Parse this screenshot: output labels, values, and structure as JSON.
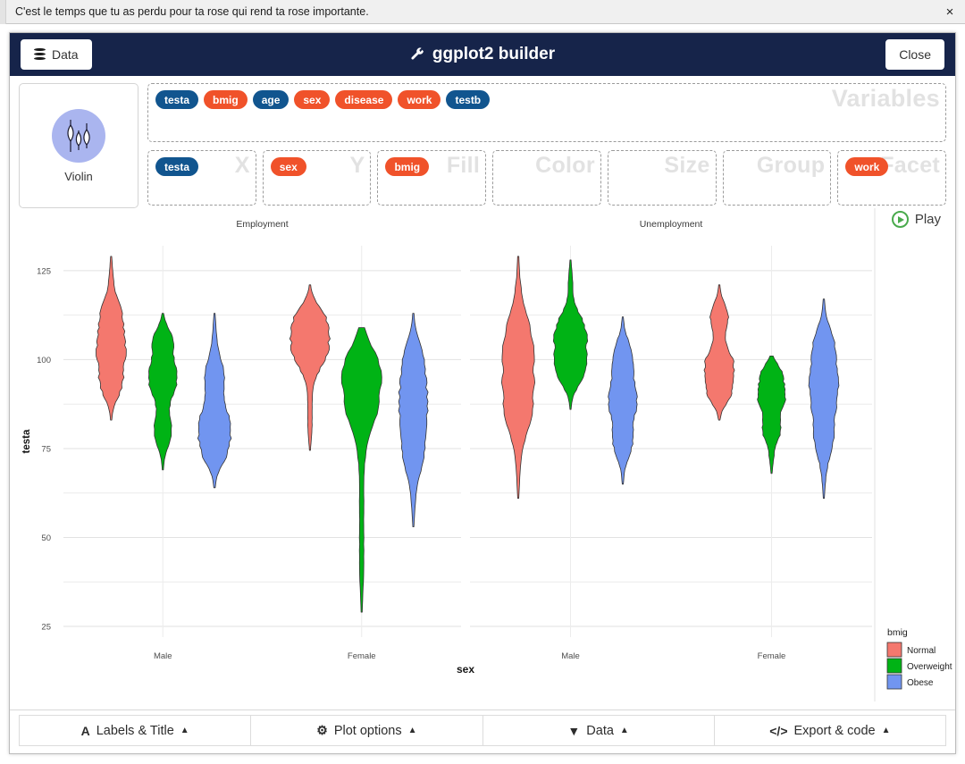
{
  "notice": {
    "text": "C'est le temps que tu as perdu pour ta rose qui rend ta rose importante.",
    "close_icon": "close-icon",
    "close_glyph": "×"
  },
  "header": {
    "data_button": "Data",
    "data_icon": "database-icon",
    "title": "ggplot2 builder",
    "title_icon": "wrench-icon",
    "title_glyph": "🔧",
    "close_button": "Close"
  },
  "geom": {
    "name": "Violin",
    "icon": "violin-plot-icon"
  },
  "variables": {
    "ghost_label": "Variables",
    "items": [
      {
        "label": "testa",
        "type": "num"
      },
      {
        "label": "bmig",
        "type": "cat"
      },
      {
        "label": "age",
        "type": "num"
      },
      {
        "label": "sex",
        "type": "cat"
      },
      {
        "label": "disease",
        "type": "cat"
      },
      {
        "label": "work",
        "type": "cat"
      },
      {
        "label": "testb",
        "type": "num"
      }
    ]
  },
  "slots": [
    {
      "ghost_label": "X",
      "pills": [
        {
          "label": "testa",
          "type": "num"
        }
      ]
    },
    {
      "ghost_label": "Y",
      "pills": [
        {
          "label": "sex",
          "type": "cat"
        }
      ]
    },
    {
      "ghost_label": "Fill",
      "pills": [
        {
          "label": "bmig",
          "type": "cat"
        }
      ]
    },
    {
      "ghost_label": "Color",
      "pills": []
    },
    {
      "ghost_label": "Size",
      "pills": []
    },
    {
      "ghost_label": "Group",
      "pills": []
    },
    {
      "ghost_label": "Facet",
      "pills": [
        {
          "label": "work",
          "type": "cat"
        }
      ]
    }
  ],
  "play": {
    "label": "Play",
    "icon": "play-circle-icon"
  },
  "bottom_bar": [
    {
      "label": "Labels & Title",
      "icon": "font-icon",
      "glyph": "A",
      "caret": "▲"
    },
    {
      "label": "Plot options",
      "icon": "sliders-icon",
      "glyph": "⚙",
      "caret": "▲"
    },
    {
      "label": "Data",
      "icon": "filter-icon",
      "glyph": "▼",
      "caret": "▲"
    },
    {
      "label": "Export & code",
      "icon": "code-icon",
      "glyph": "</>",
      "caret": "▲"
    }
  ],
  "chart_data": {
    "type": "violin",
    "title": "",
    "xlabel": "sex",
    "ylabel": "testa",
    "ylim": [
      22,
      132
    ],
    "yticks": [
      25,
      50,
      75,
      100,
      125
    ],
    "yminor": [
      37.5,
      62.5,
      87.5,
      112.5
    ],
    "grid": true,
    "categories": [
      "Male",
      "Female"
    ],
    "facet_var": "work",
    "facets": [
      "Employment",
      "Unemployment"
    ],
    "legend": {
      "title": "bmig",
      "position": "right",
      "entries": [
        {
          "label": "Normal",
          "color": "#f4786e"
        },
        {
          "label": "Overweight",
          "color": "#00b315"
        },
        {
          "label": "Obese",
          "color": "#7195f0"
        }
      ]
    },
    "series": [
      {
        "name": "Normal",
        "color": "#f4786e",
        "violins": [
          {
            "facet": "Employment",
            "category": "Male",
            "min": 83,
            "max": 129,
            "median": 103,
            "q1": 93,
            "q3": 113
          },
          {
            "facet": "Employment",
            "category": "Female",
            "min": 74.5,
            "max": 121,
            "median": 106,
            "q1": 101,
            "q3": 112
          },
          {
            "facet": "Unemployment",
            "category": "Male",
            "min": 61,
            "max": 129,
            "median": 96,
            "q1": 84,
            "q3": 108
          },
          {
            "facet": "Unemployment",
            "category": "Female",
            "min": 83,
            "max": 121,
            "median": 98,
            "q1": 90,
            "q3": 112
          }
        ]
      },
      {
        "name": "Overweight",
        "color": "#00b315",
        "violins": [
          {
            "facet": "Employment",
            "category": "Male",
            "min": 69,
            "max": 113,
            "median": 95,
            "q1": 80,
            "q3": 106
          },
          {
            "facet": "Employment",
            "category": "Female",
            "min": 29,
            "max": 109,
            "median": 96,
            "q1": 86,
            "q3": 104
          },
          {
            "facet": "Unemployment",
            "category": "Male",
            "min": 86,
            "max": 128,
            "median": 103,
            "q1": 96,
            "q3": 110
          },
          {
            "facet": "Unemployment",
            "category": "Female",
            "min": 68,
            "max": 101,
            "median": 90,
            "q1": 80,
            "q3": 98
          }
        ]
      },
      {
        "name": "Obese",
        "color": "#7195f0",
        "violins": [
          {
            "facet": "Employment",
            "category": "Male",
            "min": 64,
            "max": 113,
            "median": 82,
            "q1": 74,
            "q3": 96
          },
          {
            "facet": "Employment",
            "category": "Female",
            "min": 53,
            "max": 113,
            "median": 87,
            "q1": 73,
            "q3": 100
          },
          {
            "facet": "Unemployment",
            "category": "Male",
            "min": 65,
            "max": 112,
            "median": 89,
            "q1": 77,
            "q3": 101
          },
          {
            "facet": "Unemployment",
            "category": "Female",
            "min": 61,
            "max": 117,
            "median": 92,
            "q1": 78,
            "q3": 104
          }
        ]
      }
    ]
  }
}
